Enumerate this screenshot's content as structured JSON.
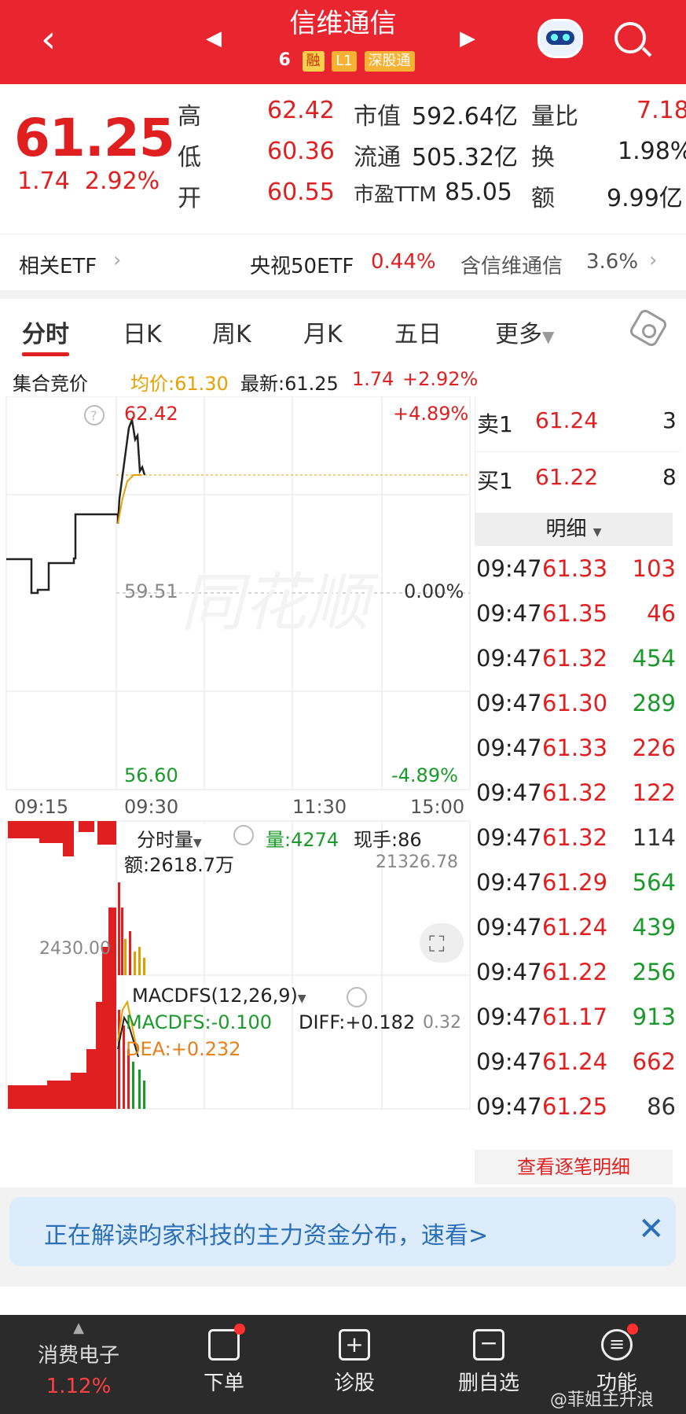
{
  "header": {
    "title": "信维通信",
    "tag_number": "6",
    "tags": [
      "融",
      "L1",
      "深股通"
    ]
  },
  "quote": {
    "price": "61.25",
    "change": "1.74",
    "change_pct": "2.92%",
    "high_label": "高",
    "high": "62.42",
    "low_label": "低",
    "low": "60.36",
    "open_label": "开",
    "open": "60.55",
    "mcap_label": "市值",
    "mcap": "592.64亿",
    "float_label": "流通",
    "float": "505.32亿",
    "pe_label": "市盈TTM",
    "pe": "85.05",
    "vol_ratio_label": "量比",
    "vol_ratio": "7.18",
    "turnover_label": "换",
    "turnover": "1.98%",
    "amount_label": "额",
    "amount": "9.99亿"
  },
  "etf": {
    "label": "相关ETF",
    "name": "央视50ETF",
    "pct": "0.44%",
    "holding_label": "含信维通信",
    "holding_pct": "3.6%"
  },
  "tabs": [
    "分时",
    "日K",
    "周K",
    "月K",
    "五日",
    "更多"
  ],
  "infobar": {
    "auction": "集合竞价",
    "avg": "均价:61.30",
    "latest": "最新:61.25",
    "chg": "1.74",
    "pct": "+2.92%"
  },
  "chart": {
    "high_label": "62.42",
    "high_pct": "+4.89%",
    "mid_label": "59.51",
    "mid_pct": "0.00%",
    "low_label": "56.60",
    "low_pct": "-4.89%",
    "times": [
      "09:15",
      "09:30",
      "11:30",
      "15:00"
    ],
    "watermark": "同花顺",
    "vol_title": "分时量",
    "vol_value": "量:4274",
    "vol_now": "现手:86",
    "vol_amount": "额:2618.7万",
    "vol_max": "21326.78",
    "vol_left": "2430.00",
    "macd_title": "MACDFS(12,26,9)",
    "macd_value": "MACDFS:-0.100",
    "diff": "DIFF:+0.182",
    "dea": "DEA:+0.232",
    "macd_right": "0.32"
  },
  "order_book": {
    "sell_label": "卖1",
    "sell_price": "61.24",
    "sell_qty": "3",
    "buy_label": "买1",
    "buy_price": "61.22",
    "buy_qty": "8",
    "detail_btn": "明细"
  },
  "ticks": [
    {
      "t": "09:47",
      "p": "61.33",
      "q": "103",
      "qc": "red"
    },
    {
      "t": "09:47",
      "p": "61.35",
      "q": "46",
      "qc": "red"
    },
    {
      "t": "09:47",
      "p": "61.32",
      "q": "454",
      "qc": "green"
    },
    {
      "t": "09:47",
      "p": "61.30",
      "q": "289",
      "qc": "green"
    },
    {
      "t": "09:47",
      "p": "61.33",
      "q": "226",
      "qc": "red"
    },
    {
      "t": "09:47",
      "p": "61.32",
      "q": "122",
      "qc": "red"
    },
    {
      "t": "09:47",
      "p": "61.32",
      "q": "114",
      "qc": "gray"
    },
    {
      "t": "09:47",
      "p": "61.29",
      "q": "564",
      "qc": "green"
    },
    {
      "t": "09:47",
      "p": "61.24",
      "q": "439",
      "qc": "green"
    },
    {
      "t": "09:47",
      "p": "61.22",
      "q": "256",
      "qc": "green"
    },
    {
      "t": "09:47",
      "p": "61.17",
      "q": "913",
      "qc": "green"
    },
    {
      "t": "09:47",
      "p": "61.24",
      "q": "662",
      "qc": "red"
    },
    {
      "t": "09:47",
      "p": "61.25",
      "q": "86",
      "qc": "gray"
    }
  ],
  "view_all": "查看逐笔明细",
  "banner": {
    "text": "正在解读昀家科技的主力资金分布，速看>"
  },
  "bottom_nav": {
    "sector": "消费电子",
    "sector_pct": "1.12%",
    "items": [
      "下单",
      "诊股",
      "删自选",
      "功能"
    ]
  },
  "watermark": "@菲姐主升浪",
  "colors": {
    "header_red": "#e9262f",
    "up": "#e02020",
    "down": "#1a9a2a",
    "avg_line": "#e6a100"
  }
}
